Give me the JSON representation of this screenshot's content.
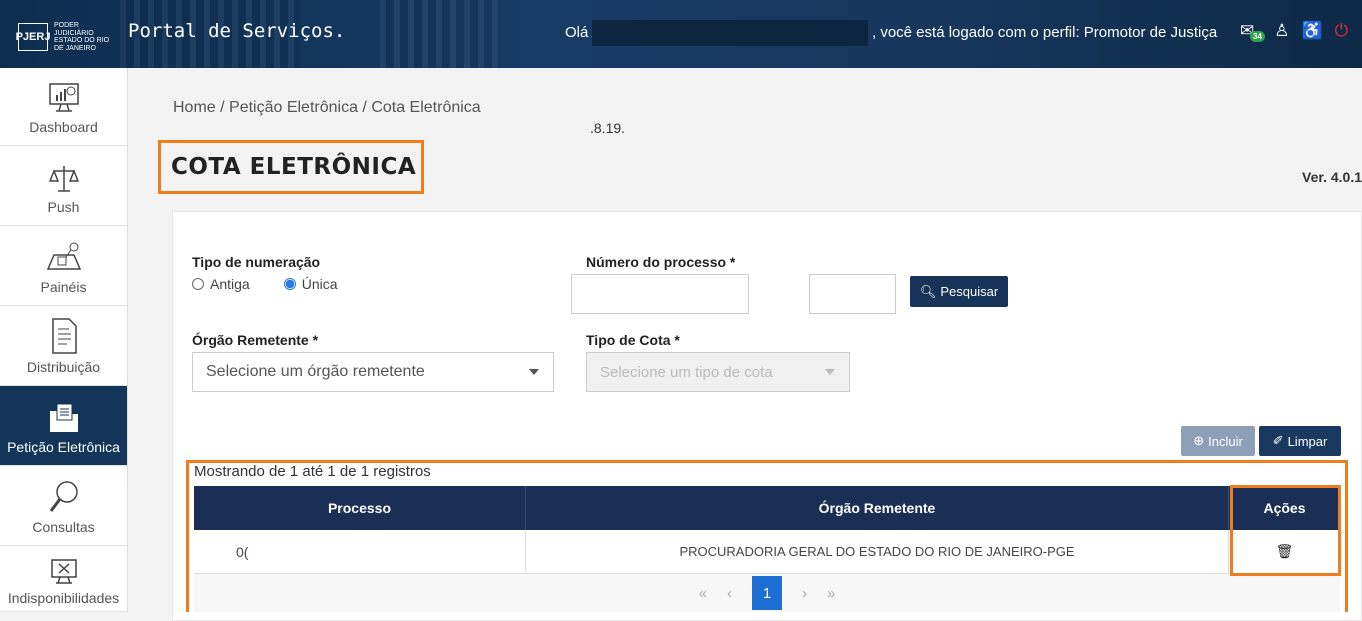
{
  "header": {
    "logo_text": "PJERJ",
    "logo_sub": "PODER JUDICIÁRIO ESTADO DO RIO DE JANEIRO",
    "portal_title": "Portal de Serviços.",
    "greeting": "Olá A",
    "profile_text": ", você está logado com o perfil: Promotor de Justiça",
    "badge_count": "34"
  },
  "sidebar": {
    "items": [
      {
        "label": "Dashboard"
      },
      {
        "label": "Push"
      },
      {
        "label": "Painéis"
      },
      {
        "label": "Distribuição"
      },
      {
        "label": "Petição Eletrônica"
      },
      {
        "label": "Consultas"
      },
      {
        "label": "Indisponibilidades"
      }
    ]
  },
  "breadcrumb": "Home  /  Petição Eletrônica / Cota Eletrônica",
  "page_title": "COTA ELETRÔNICA",
  "version": "Ver. 4.0.1",
  "form": {
    "tipo_numeracao_label": "Tipo de numeração",
    "radio_antiga": "Antiga",
    "radio_unica": "Única",
    "numero_processo_label": "Número do processo *",
    "numero_sep": ".8.19.",
    "pesquisar_label": "Pesquisar",
    "orgao_label": "Órgão Remetente *",
    "orgao_placeholder": "Selecione um órgão remetente",
    "tipo_cota_label": "Tipo de Cota *",
    "tipo_cota_placeholder": "Selecione um tipo de cota",
    "incluir_label": "Incluir",
    "limpar_label": "Limpar"
  },
  "table": {
    "showing": "Mostrando de 1 até 1 de 1 registros",
    "columns": [
      "Processo",
      "Órgão Remetente",
      "Ações"
    ],
    "rows": [
      {
        "processo": "0(",
        "orgao": "PROCURADORIA GERAL DO ESTADO DO RIO DE JANEIRO-PGE"
      }
    ],
    "pagination": {
      "first": "«",
      "prev": "‹",
      "current": "1",
      "next": "›",
      "last": "»"
    }
  }
}
